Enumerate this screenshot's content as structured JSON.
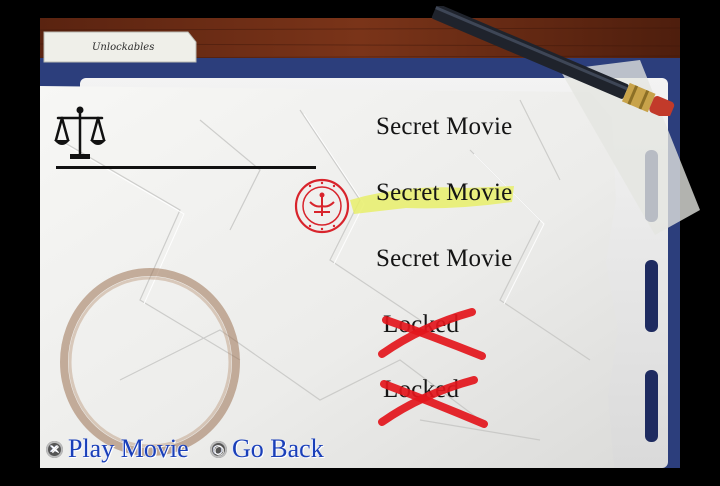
{
  "header": {
    "folder_tab_label": "Unlockables"
  },
  "menu": {
    "items": [
      {
        "label": "Secret Movie",
        "state": "unlocked",
        "highlighted": false
      },
      {
        "label": "Secret Movie",
        "state": "unlocked",
        "highlighted": true
      },
      {
        "label": "Secret Movie",
        "state": "unlocked",
        "highlighted": false
      },
      {
        "label": "Locked",
        "state": "locked",
        "highlighted": false
      },
      {
        "label": "Locked",
        "state": "locked",
        "highlighted": false
      }
    ]
  },
  "prompts": {
    "confirm": {
      "button_icon": "cross-button-icon",
      "label": "Play Movie"
    },
    "back": {
      "button_icon": "circle-button-icon",
      "label": "Go Back"
    }
  },
  "icons": [
    "scales-of-justice-icon",
    "seal-stamp-icon",
    "pencil-icon",
    "cross-out-mark-icon",
    "coffee-ring-stain"
  ],
  "colors": {
    "prompt_text": "#1a3fb8",
    "highlight": "#e8ee6a",
    "stamp": "#d8242c",
    "cross_out": "#e3161c",
    "desk_wood": "#6b2c16",
    "folder_blue": "#2c3e7c",
    "paper": "#f4f4f2"
  }
}
